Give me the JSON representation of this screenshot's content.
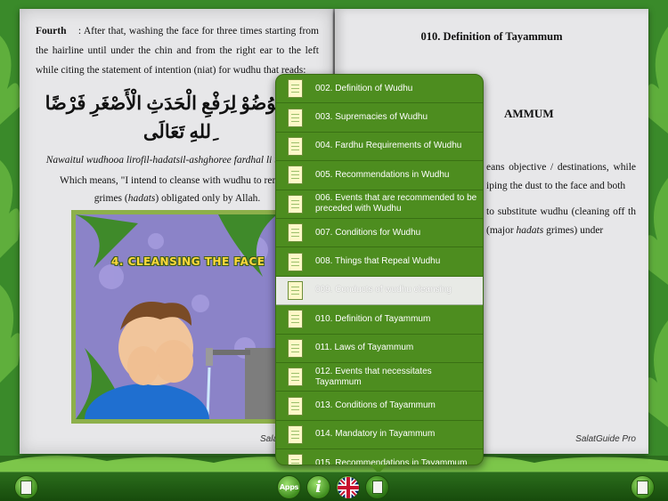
{
  "left_page": {
    "label": "Fourth",
    "text": "After that, washing the face for three times starting from the hairline until under the chin and from the right ear to the left while citing the statement of intention (niat) for wudhu that reads:",
    "arabic": "تُ الْوُضُوْ لِرَفْعِ الْحَدَثِ الْأَصْغَرِ فَرْضًا ِللهِ تَعَالَى",
    "transliteration": "Nawaitul wudhooa lirofil-hadatsil-ashghoree fardhal li taaalaa.",
    "meaning_part1": "Which means, \"I intend to cleanse with wudhu to remove",
    "meaning_part2": "grimes (",
    "meaning_hadats": "hadats",
    "meaning_part3": ") obligated only by Allah.",
    "illustration_title": "4. CLEANSING THE FACE",
    "footer": "SalatGuide Pro"
  },
  "right_page": {
    "title": "010. Definition of Tayammum",
    "heading": "AMMUM",
    "para1": "eans objective / destinations, while iping the dust to the face and both",
    "para2_a": "to substitute wudhu (cleaning off",
    "para2_b": "th (major",
    "para2_hadats": "hadats",
    "para2_c": "grimes) under",
    "footer": "SalatGuide Pro"
  },
  "toc": {
    "items": [
      {
        "label": "002. Definition of Wudhu"
      },
      {
        "label": "003. Supremacies of Wudhu"
      },
      {
        "label": "004. Fardhu Requirements of Wudhu"
      },
      {
        "label": "005. Recommendations in Wudhu"
      },
      {
        "label": "006. Events that are recommended to be preceded with Wudhu"
      },
      {
        "label": "007. Conditions for Wudhu"
      },
      {
        "label": "008. Things that Repeal Wudhu"
      },
      {
        "label": "009. Conducts of wudhu cleansing"
      },
      {
        "label": "010. Definition of Tayammum"
      },
      {
        "label": "011. Laws of Tayammum"
      },
      {
        "label": "012. Events that necessitates Tayammum"
      },
      {
        "label": "013. Conditions of Tayammum"
      },
      {
        "label": "014. Mandatory in Tayammum"
      },
      {
        "label": "015. Recommendations in Tayammum"
      }
    ],
    "selected_index": 7
  },
  "bottom_bar": {
    "apps_label": "Apps",
    "info_label": "i",
    "icons": [
      "book-icon",
      "apps-icon",
      "info-icon",
      "uk-flag-icon",
      "contents-icon",
      "book-icon"
    ]
  },
  "colors": {
    "toc_background": "#4d8d1f",
    "toc_selected": "#e8eae6",
    "page_background": "#e7e7e9",
    "bar_background": "#174b0c"
  }
}
